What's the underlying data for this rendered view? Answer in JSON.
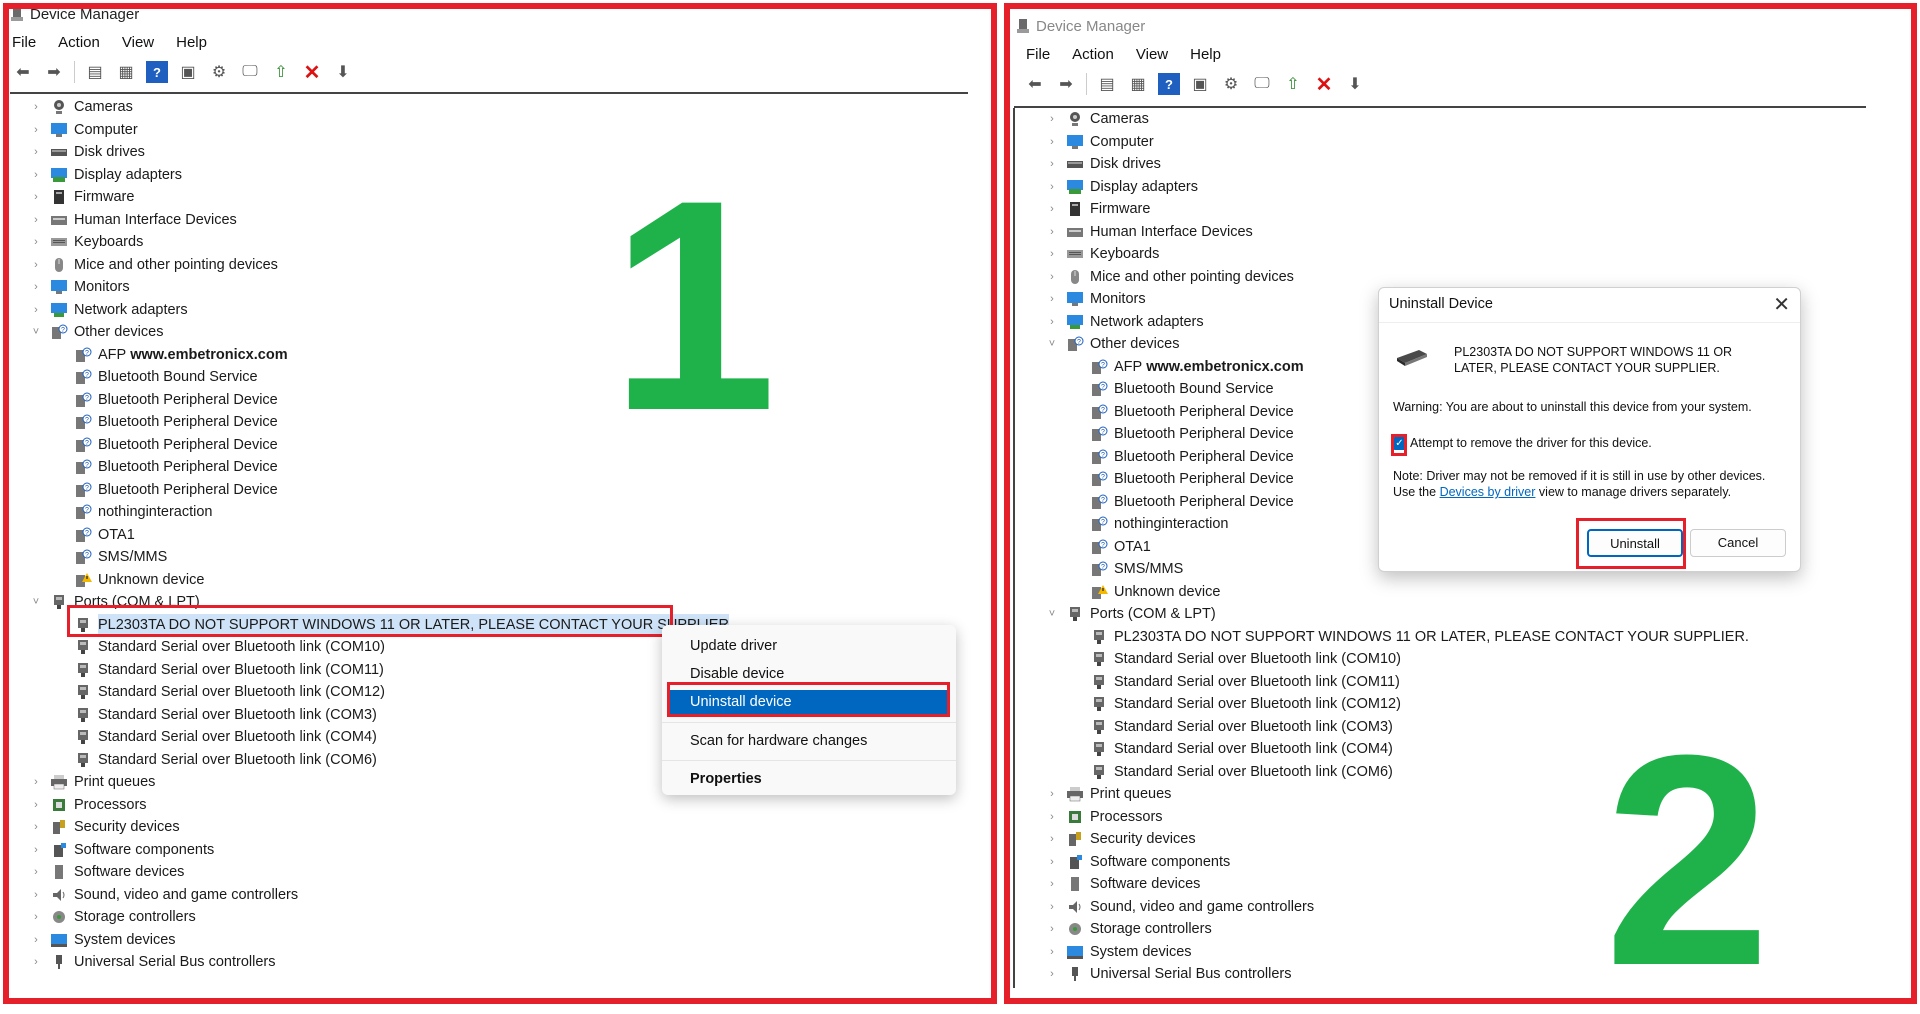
{
  "window": {
    "title": "Device Manager"
  },
  "menu": [
    "File",
    "Action",
    "View",
    "Help"
  ],
  "colors": {
    "highlight_red": "#e5202a",
    "number_green": "#1fb24a",
    "selection_blue": "#0067c0"
  },
  "tree": [
    {
      "label": "Cameras",
      "icon": "camera-icon",
      "expanded": false
    },
    {
      "label": "Computer",
      "icon": "monitor-icon",
      "expanded": false
    },
    {
      "label": "Disk drives",
      "icon": "disk-icon",
      "expanded": false
    },
    {
      "label": "Display adapters",
      "icon": "display-adapter-icon",
      "expanded": false
    },
    {
      "label": "Firmware",
      "icon": "firmware-icon",
      "expanded": false
    },
    {
      "label": "Human Interface Devices",
      "icon": "hid-icon",
      "expanded": false
    },
    {
      "label": "Keyboards",
      "icon": "keyboard-icon",
      "expanded": false
    },
    {
      "label": "Mice and other pointing devices",
      "icon": "mouse-icon",
      "expanded": false
    },
    {
      "label": "Monitors",
      "icon": "monitor-icon",
      "expanded": false
    },
    {
      "label": "Network adapters",
      "icon": "network-icon",
      "expanded": false
    },
    {
      "label": "Other devices",
      "icon": "unknown-device-icon",
      "expanded": true,
      "children": [
        {
          "label": "AFP",
          "extra": "www.embetronicx.com",
          "icon": "unknown-device-icon"
        },
        {
          "label": "Bluetooth Bound Service",
          "icon": "unknown-device-icon"
        },
        {
          "label": "Bluetooth Peripheral Device",
          "icon": "unknown-device-icon"
        },
        {
          "label": "Bluetooth Peripheral Device",
          "icon": "unknown-device-icon"
        },
        {
          "label": "Bluetooth Peripheral Device",
          "icon": "unknown-device-icon"
        },
        {
          "label": "Bluetooth Peripheral Device",
          "icon": "unknown-device-icon"
        },
        {
          "label": "Bluetooth Peripheral Device",
          "icon": "unknown-device-icon"
        },
        {
          "label": "nothinginteraction",
          "icon": "unknown-device-icon"
        },
        {
          "label": "OTA1",
          "icon": "unknown-device-icon"
        },
        {
          "label": "SMS/MMS",
          "icon": "unknown-device-icon"
        },
        {
          "label": "Unknown device",
          "icon": "warning-device-icon"
        }
      ]
    },
    {
      "label": "Ports (COM & LPT)",
      "icon": "port-icon",
      "expanded": true,
      "children": [
        {
          "label": "PL2303TA DO NOT SUPPORT WINDOWS 11 OR LATER, PLEASE CONTACT YOUR SUPPLIER.",
          "icon": "port-icon"
        },
        {
          "label": "Standard Serial over Bluetooth link (COM10)",
          "icon": "port-icon"
        },
        {
          "label": "Standard Serial over Bluetooth link (COM11)",
          "icon": "port-icon"
        },
        {
          "label": "Standard Serial over Bluetooth link (COM12)",
          "icon": "port-icon"
        },
        {
          "label": "Standard Serial over Bluetooth link (COM3)",
          "icon": "port-icon"
        },
        {
          "label": "Standard Serial over Bluetooth link (COM4)",
          "icon": "port-icon"
        },
        {
          "label": "Standard Serial over Bluetooth link (COM6)",
          "icon": "port-icon"
        }
      ]
    },
    {
      "label": "Print queues",
      "icon": "printer-icon",
      "expanded": false
    },
    {
      "label": "Processors",
      "icon": "processor-icon",
      "expanded": false
    },
    {
      "label": "Security devices",
      "icon": "security-icon",
      "expanded": false
    },
    {
      "label": "Software components",
      "icon": "software-component-icon",
      "expanded": false
    },
    {
      "label": "Software devices",
      "icon": "software-device-icon",
      "expanded": false
    },
    {
      "label": "Sound, video and game controllers",
      "icon": "speaker-icon",
      "expanded": false
    },
    {
      "label": "Storage controllers",
      "icon": "storage-icon",
      "expanded": false
    },
    {
      "label": "System devices",
      "icon": "system-icon",
      "expanded": false
    },
    {
      "label": "Universal Serial Bus controllers",
      "icon": "usb-icon",
      "expanded": false
    }
  ],
  "panel1": {
    "selected_label": "PL2303TA DO NOT SUPPORT WINDOWS 11 OR LATER, PLEASE CONTACT YOUR SUPPLIER",
    "step_number": "1",
    "context_menu": {
      "update_driver": "Update driver",
      "disable_device": "Disable device",
      "uninstall_device": "Uninstall device",
      "scan": "Scan for hardware changes",
      "properties": "Properties"
    }
  },
  "panel2": {
    "step_number": "2",
    "dialog": {
      "title": "Uninstall Device",
      "device_name": "PL2303TA DO NOT SUPPORT WINDOWS 11 OR LATER, PLEASE CONTACT YOUR SUPPLIER.",
      "warning": "Warning: You are about to uninstall this device from your system.",
      "checkbox_label": "Attempt to remove the driver for this device.",
      "checkbox_checked": true,
      "note_before": "Note: Driver may not be removed if it is still in use by other devices. Use the ",
      "note_link": "Devices by driver",
      "note_after": " view to manage drivers separately.",
      "uninstall_button": "Uninstall",
      "cancel_button": "Cancel"
    }
  }
}
